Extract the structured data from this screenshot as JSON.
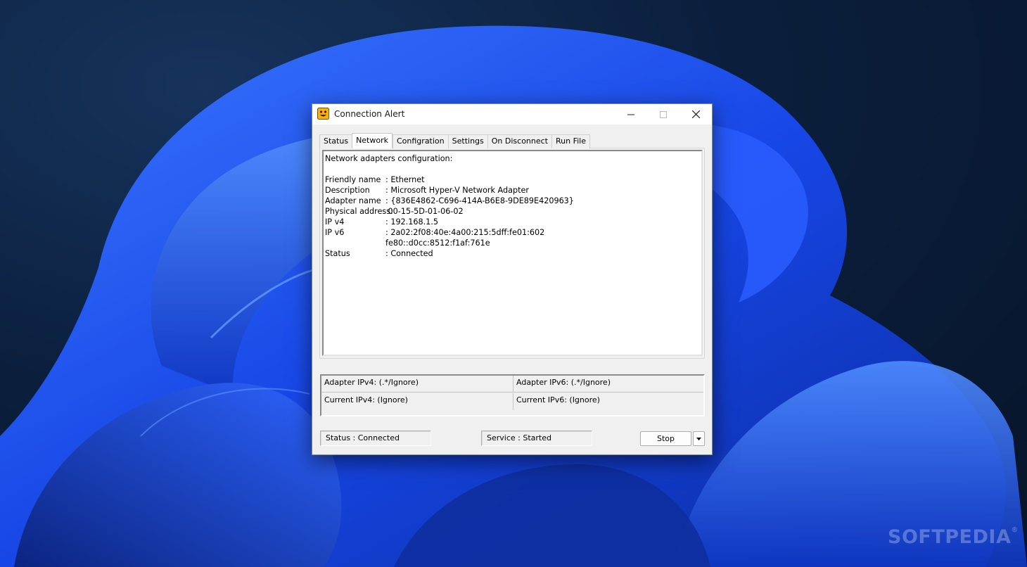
{
  "window": {
    "title": "Connection Alert",
    "icon": "smiley-app-icon",
    "controls": {
      "minimize": "minimize-icon",
      "maximize": "maximize-icon",
      "close": "close-icon"
    }
  },
  "tabs": [
    {
      "label": "Status",
      "active": false
    },
    {
      "label": "Network",
      "active": true
    },
    {
      "label": "Configration",
      "active": false
    },
    {
      "label": "Settings",
      "active": false
    },
    {
      "label": "On Disconnect",
      "active": false
    },
    {
      "label": "Run File",
      "active": false
    }
  ],
  "network_panel": {
    "heading": "Network adapters configuration:",
    "rows": [
      {
        "key": "Friendly name",
        "value": ": Ethernet"
      },
      {
        "key": "Description",
        "value": ": Microsoft Hyper-V Network Adapter"
      },
      {
        "key": "Adapter name",
        "value": ": {836E4862-C696-414A-B6E8-9DE89E420963}"
      },
      {
        "key": "Physical address:",
        "value": " 00-15-5D-01-06-02"
      },
      {
        "key": "IP v4",
        "value": ": 192.168.1.5"
      },
      {
        "key": "IP v6",
        "value": ": 2a02:2f08:40e:4a00:215:5dff:fe01:602"
      },
      {
        "key": "",
        "value": "fe80::d0cc:8512:f1af:761e"
      },
      {
        "key": "Status",
        "value": ": Connected"
      }
    ]
  },
  "ip_grid": {
    "adapter_ipv4": "Adapter IPv4: (.*/Ignore)",
    "adapter_ipv6": "Adapter IPv6: (.*/Ignore)",
    "current_ipv4": "Current IPv4: (Ignore)",
    "current_ipv6": "Current IPv6: (Ignore)"
  },
  "footer": {
    "status": "Status : Connected",
    "service": "Service : Started",
    "stop_label": "Stop",
    "dropdown_icon": "triangle-down-icon"
  },
  "watermark": {
    "text": "SOFTPEDIA",
    "mark": "®"
  },
  "colors": {
    "window_bg": "#f0f0f0",
    "titlebar_bg": "#ffffff",
    "wallpaper_blue": "#1f52ff",
    "desktop_dark": "#0b1f3d"
  }
}
